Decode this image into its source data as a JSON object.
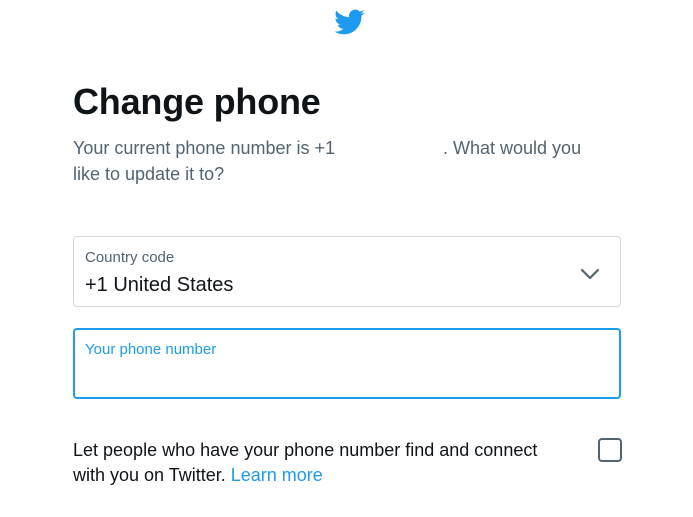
{
  "logo": {
    "icon": "twitter-bird-icon",
    "color": "#1d9bf0"
  },
  "title": "Change phone",
  "description": {
    "before": "Your current phone number is +1",
    "after": ". What would you like to update it to?"
  },
  "country_field": {
    "label": "Country code",
    "value": "+1 United States",
    "icon": "chevron-down-icon"
  },
  "phone_field": {
    "label": "Your phone number",
    "value": ""
  },
  "discoverability": {
    "text": "Let people who have your phone number find and connect with you on Twitter.",
    "link": "Learn more",
    "checked": false
  },
  "colors": {
    "accent": "#1d9bf0",
    "text_primary": "#0f1419",
    "text_secondary": "#536471",
    "border": "#cfd9de"
  }
}
